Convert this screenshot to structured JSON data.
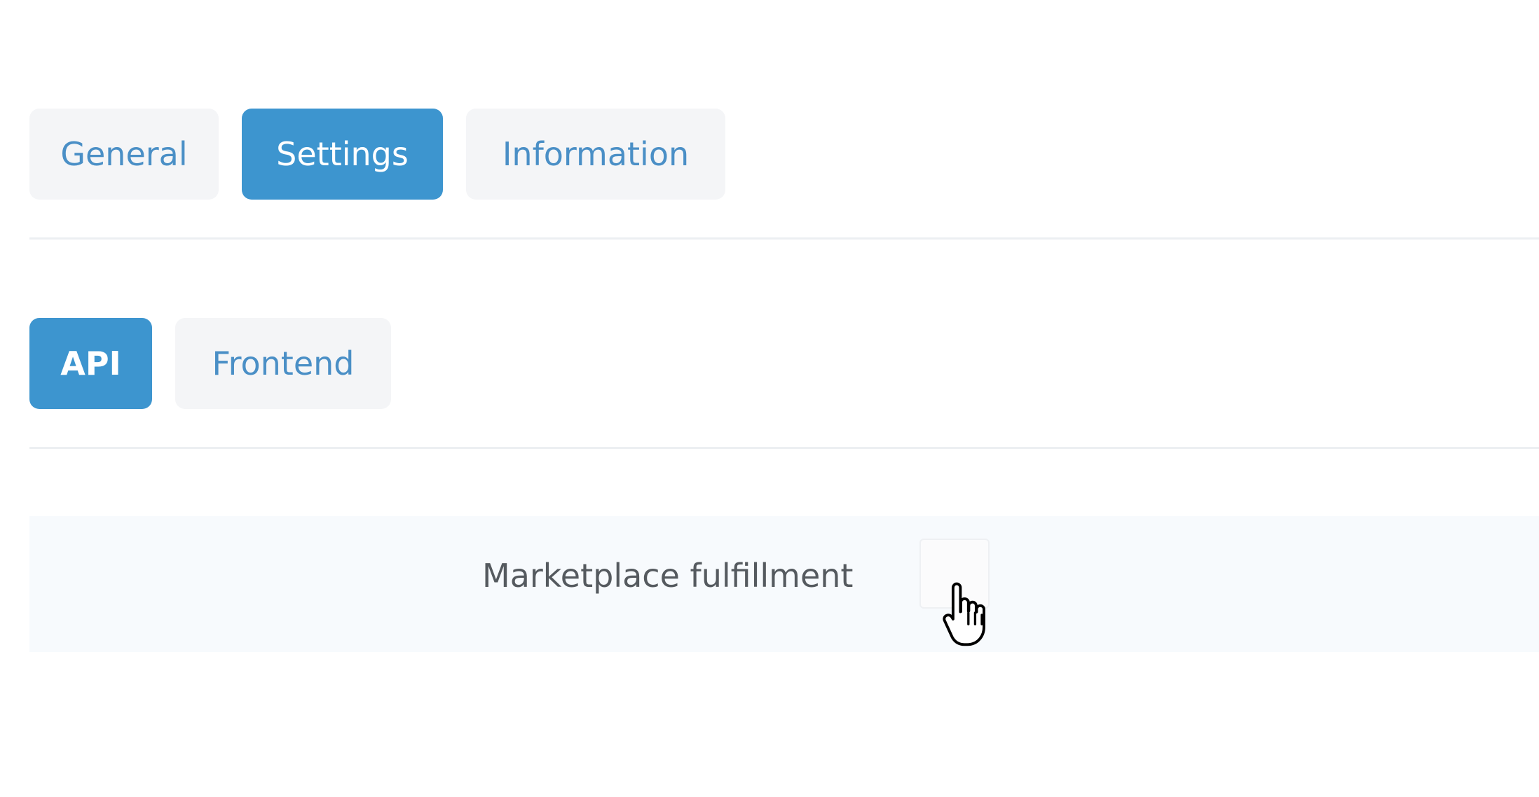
{
  "tabs": {
    "primary": [
      {
        "label": "General",
        "active": false
      },
      {
        "label": "Settings",
        "active": true
      },
      {
        "label": "Information",
        "active": false
      }
    ],
    "secondary": [
      {
        "label": "API",
        "active": true
      },
      {
        "label": "Frontend",
        "active": false
      }
    ]
  },
  "settings": {
    "marketplace_fulfillment": {
      "label": "Marketplace fulfillment",
      "checked": false
    }
  },
  "icons": {
    "cursor": "hand-pointer-icon"
  },
  "colors": {
    "accent": "#3d95cf",
    "tab_text": "#4a8fc6",
    "tab_bg": "#f4f5f7",
    "row_bg": "#f7fafd"
  }
}
